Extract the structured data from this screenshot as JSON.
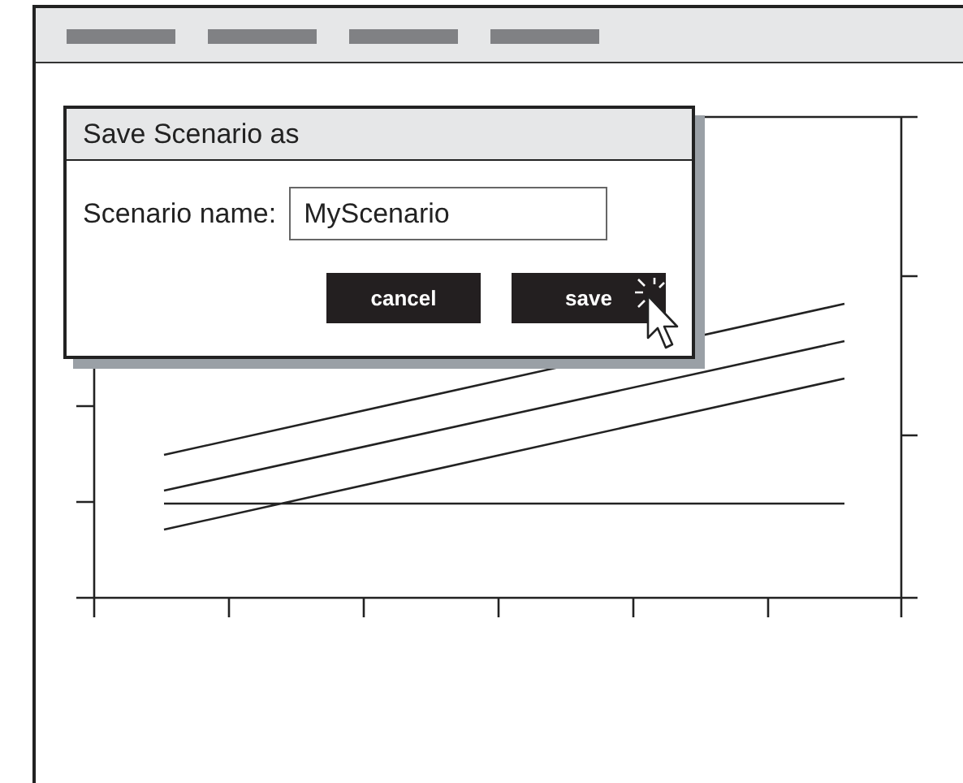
{
  "dialog": {
    "title": "Save Scenario as",
    "field": {
      "label": "Scenario name:",
      "value": "MyScenario"
    },
    "buttons": [
      {
        "label": "cancel"
      },
      {
        "label": "save"
      }
    ]
  }
}
